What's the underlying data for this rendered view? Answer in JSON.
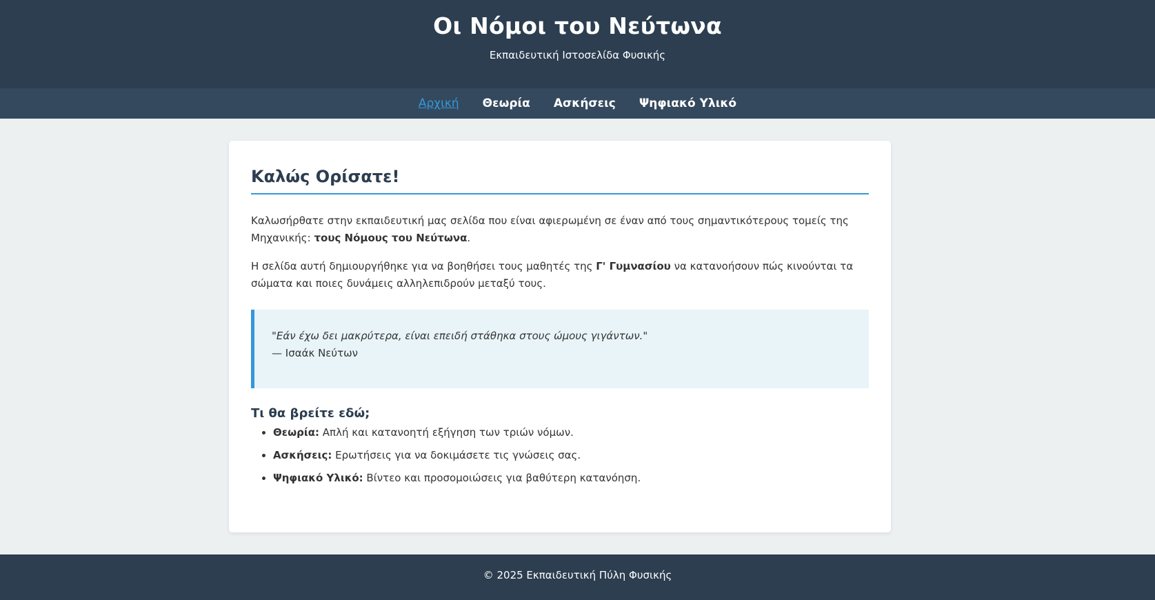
{
  "header": {
    "title": "Οι Νόμοι του Νεύτωνα",
    "subtitle": "Εκπαιδευτική Ιστοσελίδα Φυσικής"
  },
  "nav": {
    "items": [
      {
        "label": "Αρχική"
      },
      {
        "label": "Θεωρία"
      },
      {
        "label": "Ασκήσεις"
      },
      {
        "label": "Ψηφιακό Υλικό"
      }
    ]
  },
  "main": {
    "heading": "Καλώς Ορίσατε!",
    "p1": {
      "text": "Καλωσήρθατε στην εκπαιδευτική μας σελίδα που είναι αφιερωμένη σε έναν από τους σημαντικότερους τομείς της Μηχανικής: ",
      "bold": "τους Νόμους του Νεύτωνα",
      "end": "."
    },
    "p2": {
      "text": "Η σελίδα αυτή δημιουργήθηκε για να βοηθήσει τους μαθητές της ",
      "bold": "Γ' Γυμνασίου",
      "end": " να κατανοήσουν πώς κινούνται τα σώματα και ποιες δυνάμεις αλληλεπιδρούν μεταξύ τους."
    },
    "quote": {
      "text": "\"Εάν έχω δει μακρύτερα, είναι επειδή στάθηκα στους ώμους γιγάντων.\"",
      "author": "— Ισαάκ Νεύτων"
    },
    "features_heading": "Τι θα βρείτε εδώ;",
    "features": [
      {
        "label": "Θεωρία:",
        "text": " Απλή και κατανοητή εξήγηση των τριών νόμων."
      },
      {
        "label": "Ασκήσεις:",
        "text": " Ερωτήσεις για να δοκιμάσετε τις γνώσεις σας."
      },
      {
        "label": "Ψηφιακό Υλικό:",
        "text": " Βίντεο και προσομοιώσεις για βαθύτερη κατανόηση."
      }
    ]
  },
  "footer": {
    "text": "© 2025 Εκπαιδευτική Πύλη Φυσικής"
  },
  "colors": {
    "header_bg": "#2c3e50",
    "nav_bg": "#34495e",
    "accent": "#3498db",
    "page_bg": "#ecf0f1",
    "quote_bg": "#e8f4f8"
  }
}
